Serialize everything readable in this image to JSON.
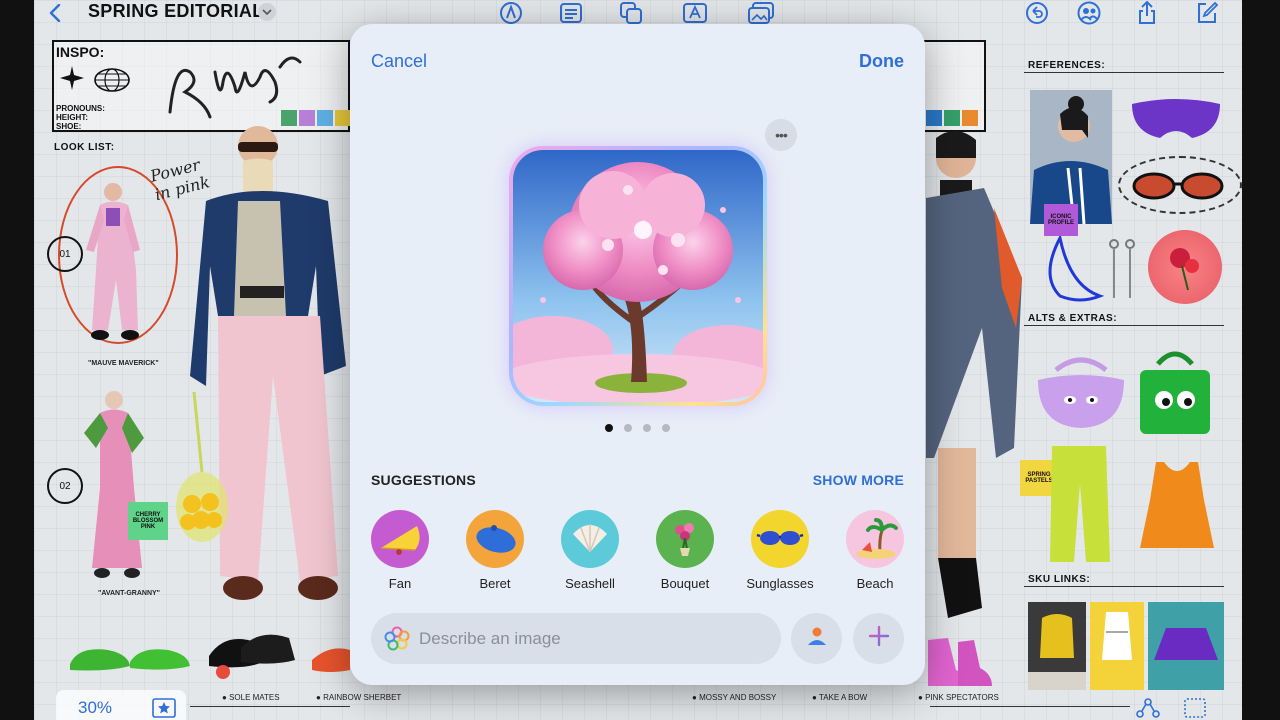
{
  "toolbar": {
    "doc_title": "SPRING EDITORIAL"
  },
  "board": {
    "inspo_title": "INSPO:",
    "inspo_fields": [
      "PRONOUNS:",
      "HEIGHT:",
      "SHOE:"
    ],
    "look_list": "LOOK LIST:",
    "references": "REFERENCES:",
    "alts_extras": "ALTS & EXTRAS:",
    "sku_links": "SKU LINKS:",
    "captions": {
      "mauve": "\"MAUVE MAVERICK\"",
      "granny": "\"AVANT-GRANNY\""
    },
    "numbers": [
      "01",
      "02"
    ],
    "stickies": {
      "cherry": "CHERRY BLOSSOM PINK",
      "spring": "SPRING PASTELS",
      "iconic": "ICONIC PROFILE"
    },
    "bottom_labels": [
      "SOLE MATES",
      "RAINBOW SHERBET",
      "MOSSY AND BOSSY",
      "TAKE A BOW",
      "PINK SPECTATORS"
    ],
    "zoom": "30%",
    "swatch_colors": [
      "#4aa36b",
      "#b87fd6",
      "#5fb0e6",
      "#e7c93a",
      "#2b79c9",
      "#35a06a",
      "#e98a2e"
    ]
  },
  "modal": {
    "cancel": "Cancel",
    "done": "Done",
    "suggestions_title": "SUGGESTIONS",
    "show_more": "SHOW MORE",
    "suggestions": [
      {
        "label": "Fan"
      },
      {
        "label": "Beret"
      },
      {
        "label": "Seashell"
      },
      {
        "label": "Bouquet"
      },
      {
        "label": "Sunglasses"
      },
      {
        "label": "Beach"
      }
    ],
    "prompt_placeholder": "Describe an image",
    "page_count": 4,
    "active_page": 1
  },
  "colors": {
    "accent": "#2f6fd6",
    "modal_bg": "#e8eef7"
  }
}
